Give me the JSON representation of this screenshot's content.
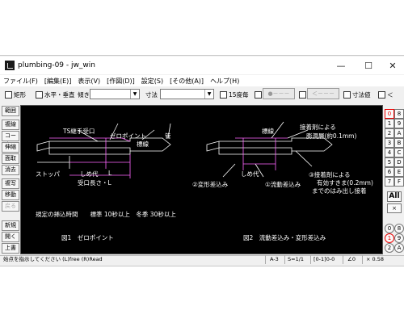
{
  "window": {
    "title": "plumbing-09 - jw_win",
    "minimize": "—",
    "maximize": "☐",
    "close": "✕"
  },
  "menu": [
    "ファイル(F)",
    "[編集(E)]",
    "表示(V)",
    "[作図(D)]",
    "設定(S)",
    "[その他(A)]",
    "ヘルプ(H)"
  ],
  "toolbar": {
    "rect": "矩形",
    "hv": "水平・垂直",
    "tilt": "傾き",
    "dim": "寸法",
    "deg15": "15度毎",
    "btn1": "●－－－",
    "btn2": "＜－－－",
    "dimval": "寸法値",
    "lt": "＜"
  },
  "left_tools": [
    "範囲",
    "複線",
    "コーナー",
    "伸縮",
    "面取",
    "消去",
    "複写",
    "移動",
    "戻る",
    "新規",
    "開く",
    "上書"
  ],
  "right_tools": [
    "0",
    "8",
    "1",
    "9",
    "2",
    "A",
    "3",
    "B",
    "4",
    "C",
    "5",
    "D",
    "6",
    "E",
    "7",
    "F"
  ],
  "right_all": "All",
  "right_x": "×",
  "right_bottom": [
    "0",
    "8",
    "1",
    "9",
    "2",
    "A"
  ],
  "drawing": {
    "fig1": {
      "ts": "TS継手受口",
      "zero": "ゼロポイント",
      "pipe": "管",
      "marker": "標線",
      "stopper": "ストッパ",
      "shime": "しめ代",
      "L": "L",
      "ukeguchi": "受口長さ・L",
      "insert": "規定の挿込時間　　標準 10秒以上　冬季 30秒以上",
      "caption": "図1　ゼロポイント"
    },
    "fig2": {
      "marker": "標線",
      "adh": "接着剤による",
      "swell": "膨潤層(約0.1mm)",
      "shime": "しめ代",
      "henkei": "②変形差込み",
      "ryudo": "①流動差込み",
      "adh2": "③接着剤による",
      "gap": "有効すきま(0.2mm)",
      "bleed": "までのはみ出し接着",
      "caption": "図2　流動差込み・変形差込み"
    }
  },
  "status": {
    "msg": "始点を指示してください (L)free (R)Read",
    "paper": "A-3",
    "scale": "S=1/1",
    "layer": "[0-1]0-0",
    "angle": "∠0",
    "zoom": "× 0.58"
  },
  "colors": {
    "canvas": "#000000",
    "line": "#ffffff",
    "accent": "#ffff00",
    "dim": "#ff66ff"
  }
}
